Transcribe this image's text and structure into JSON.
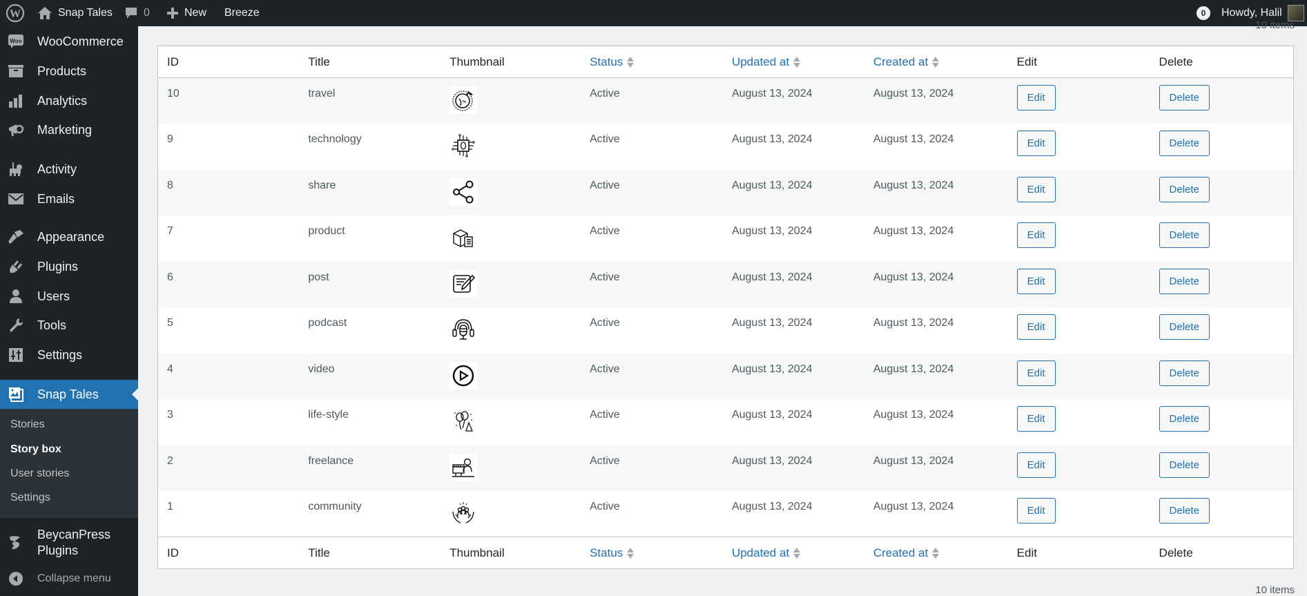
{
  "adminbar": {
    "wp_logo": "wordpress-logo",
    "site_name": "Snap Tales",
    "comments_count": "0",
    "new_label": "New",
    "breeze_label": "Breeze",
    "notification_count": "0",
    "greeting": "Howdy, Halil"
  },
  "sidebar": {
    "items": [
      {
        "label": "WooCommerce",
        "icon": "woo-icon"
      },
      {
        "label": "Products",
        "icon": "archive-icon"
      },
      {
        "label": "Analytics",
        "icon": "bar-chart-icon"
      },
      {
        "label": "Marketing",
        "icon": "megaphone-icon"
      },
      {
        "label": "Activity",
        "icon": "activity-icon"
      },
      {
        "label": "Emails",
        "icon": "envelope-icon"
      },
      {
        "label": "Appearance",
        "icon": "paintbrush-icon"
      },
      {
        "label": "Plugins",
        "icon": "plug-icon"
      },
      {
        "label": "Users",
        "icon": "user-icon"
      },
      {
        "label": "Tools",
        "icon": "wrench-icon"
      },
      {
        "label": "Settings",
        "icon": "settings-icon"
      },
      {
        "label": "Snap Tales",
        "icon": "gallery-icon"
      },
      {
        "label": "BeycanPress Plugins",
        "icon": "beycan-icon"
      },
      {
        "label": "Collapse menu",
        "icon": "collapse-icon"
      }
    ],
    "submenu": [
      "Stories",
      "Story box",
      "User stories",
      "Settings"
    ]
  },
  "table": {
    "item_count": "10 items",
    "columns": [
      "ID",
      "Title",
      "Thumbnail",
      "Status",
      "Updated at",
      "Created at",
      "Edit",
      "Delete"
    ],
    "edit_label": "Edit",
    "delete_label": "Delete",
    "rows": [
      {
        "id": "10",
        "title": "travel",
        "thumb": "travel-globe-icon",
        "status": "Active",
        "updated": "August 13, 2024",
        "created": "August 13, 2024"
      },
      {
        "id": "9",
        "title": "technology",
        "thumb": "chip-icon",
        "status": "Active",
        "updated": "August 13, 2024",
        "created": "August 13, 2024"
      },
      {
        "id": "8",
        "title": "share",
        "thumb": "share-icon",
        "status": "Active",
        "updated": "August 13, 2024",
        "created": "August 13, 2024"
      },
      {
        "id": "7",
        "title": "product",
        "thumb": "product-box-icon",
        "status": "Active",
        "updated": "August 13, 2024",
        "created": "August 13, 2024"
      },
      {
        "id": "6",
        "title": "post",
        "thumb": "post-edit-icon",
        "status": "Active",
        "updated": "August 13, 2024",
        "created": "August 13, 2024"
      },
      {
        "id": "5",
        "title": "podcast",
        "thumb": "podcast-mic-icon",
        "status": "Active",
        "updated": "August 13, 2024",
        "created": "August 13, 2024"
      },
      {
        "id": "4",
        "title": "video",
        "thumb": "play-icon",
        "status": "Active",
        "updated": "August 13, 2024",
        "created": "August 13, 2024"
      },
      {
        "id": "3",
        "title": "life-style",
        "thumb": "balloons-icon",
        "status": "Active",
        "updated": "August 13, 2024",
        "created": "August 13, 2024"
      },
      {
        "id": "2",
        "title": "freelance",
        "thumb": "freelancer-icon",
        "status": "Active",
        "updated": "August 13, 2024",
        "created": "August 13, 2024"
      },
      {
        "id": "1",
        "title": "community",
        "thumb": "community-hands-icon",
        "status": "Active",
        "updated": "August 13, 2024",
        "created": "August 13, 2024"
      }
    ]
  }
}
